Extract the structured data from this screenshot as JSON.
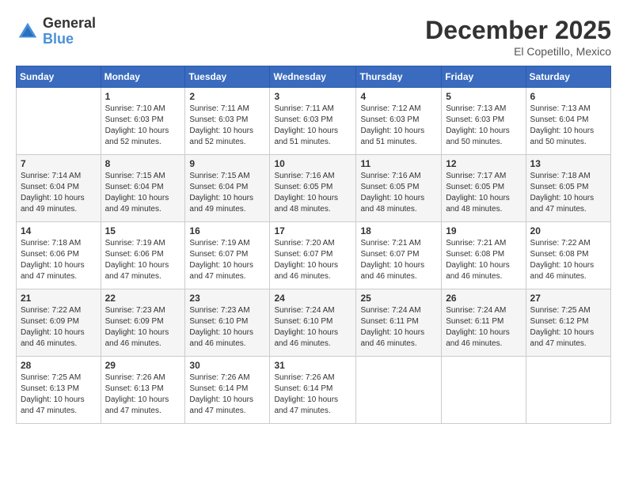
{
  "logo": {
    "general": "General",
    "blue": "Blue"
  },
  "title": "December 2025",
  "location": "El Copetillo, Mexico",
  "days_of_week": [
    "Sunday",
    "Monday",
    "Tuesday",
    "Wednesday",
    "Thursday",
    "Friday",
    "Saturday"
  ],
  "weeks": [
    [
      {
        "day": "",
        "info": ""
      },
      {
        "day": "1",
        "info": "Sunrise: 7:10 AM\nSunset: 6:03 PM\nDaylight: 10 hours\nand 52 minutes."
      },
      {
        "day": "2",
        "info": "Sunrise: 7:11 AM\nSunset: 6:03 PM\nDaylight: 10 hours\nand 52 minutes."
      },
      {
        "day": "3",
        "info": "Sunrise: 7:11 AM\nSunset: 6:03 PM\nDaylight: 10 hours\nand 51 minutes."
      },
      {
        "day": "4",
        "info": "Sunrise: 7:12 AM\nSunset: 6:03 PM\nDaylight: 10 hours\nand 51 minutes."
      },
      {
        "day": "5",
        "info": "Sunrise: 7:13 AM\nSunset: 6:03 PM\nDaylight: 10 hours\nand 50 minutes."
      },
      {
        "day": "6",
        "info": "Sunrise: 7:13 AM\nSunset: 6:04 PM\nDaylight: 10 hours\nand 50 minutes."
      }
    ],
    [
      {
        "day": "7",
        "info": "Sunrise: 7:14 AM\nSunset: 6:04 PM\nDaylight: 10 hours\nand 49 minutes."
      },
      {
        "day": "8",
        "info": "Sunrise: 7:15 AM\nSunset: 6:04 PM\nDaylight: 10 hours\nand 49 minutes."
      },
      {
        "day": "9",
        "info": "Sunrise: 7:15 AM\nSunset: 6:04 PM\nDaylight: 10 hours\nand 49 minutes."
      },
      {
        "day": "10",
        "info": "Sunrise: 7:16 AM\nSunset: 6:05 PM\nDaylight: 10 hours\nand 48 minutes."
      },
      {
        "day": "11",
        "info": "Sunrise: 7:16 AM\nSunset: 6:05 PM\nDaylight: 10 hours\nand 48 minutes."
      },
      {
        "day": "12",
        "info": "Sunrise: 7:17 AM\nSunset: 6:05 PM\nDaylight: 10 hours\nand 48 minutes."
      },
      {
        "day": "13",
        "info": "Sunrise: 7:18 AM\nSunset: 6:05 PM\nDaylight: 10 hours\nand 47 minutes."
      }
    ],
    [
      {
        "day": "14",
        "info": "Sunrise: 7:18 AM\nSunset: 6:06 PM\nDaylight: 10 hours\nand 47 minutes."
      },
      {
        "day": "15",
        "info": "Sunrise: 7:19 AM\nSunset: 6:06 PM\nDaylight: 10 hours\nand 47 minutes."
      },
      {
        "day": "16",
        "info": "Sunrise: 7:19 AM\nSunset: 6:07 PM\nDaylight: 10 hours\nand 47 minutes."
      },
      {
        "day": "17",
        "info": "Sunrise: 7:20 AM\nSunset: 6:07 PM\nDaylight: 10 hours\nand 46 minutes."
      },
      {
        "day": "18",
        "info": "Sunrise: 7:21 AM\nSunset: 6:07 PM\nDaylight: 10 hours\nand 46 minutes."
      },
      {
        "day": "19",
        "info": "Sunrise: 7:21 AM\nSunset: 6:08 PM\nDaylight: 10 hours\nand 46 minutes."
      },
      {
        "day": "20",
        "info": "Sunrise: 7:22 AM\nSunset: 6:08 PM\nDaylight: 10 hours\nand 46 minutes."
      }
    ],
    [
      {
        "day": "21",
        "info": "Sunrise: 7:22 AM\nSunset: 6:09 PM\nDaylight: 10 hours\nand 46 minutes."
      },
      {
        "day": "22",
        "info": "Sunrise: 7:23 AM\nSunset: 6:09 PM\nDaylight: 10 hours\nand 46 minutes."
      },
      {
        "day": "23",
        "info": "Sunrise: 7:23 AM\nSunset: 6:10 PM\nDaylight: 10 hours\nand 46 minutes."
      },
      {
        "day": "24",
        "info": "Sunrise: 7:24 AM\nSunset: 6:10 PM\nDaylight: 10 hours\nand 46 minutes."
      },
      {
        "day": "25",
        "info": "Sunrise: 7:24 AM\nSunset: 6:11 PM\nDaylight: 10 hours\nand 46 minutes."
      },
      {
        "day": "26",
        "info": "Sunrise: 7:24 AM\nSunset: 6:11 PM\nDaylight: 10 hours\nand 46 minutes."
      },
      {
        "day": "27",
        "info": "Sunrise: 7:25 AM\nSunset: 6:12 PM\nDaylight: 10 hours\nand 47 minutes."
      }
    ],
    [
      {
        "day": "28",
        "info": "Sunrise: 7:25 AM\nSunset: 6:13 PM\nDaylight: 10 hours\nand 47 minutes."
      },
      {
        "day": "29",
        "info": "Sunrise: 7:26 AM\nSunset: 6:13 PM\nDaylight: 10 hours\nand 47 minutes."
      },
      {
        "day": "30",
        "info": "Sunrise: 7:26 AM\nSunset: 6:14 PM\nDaylight: 10 hours\nand 47 minutes."
      },
      {
        "day": "31",
        "info": "Sunrise: 7:26 AM\nSunset: 6:14 PM\nDaylight: 10 hours\nand 47 minutes."
      },
      {
        "day": "",
        "info": ""
      },
      {
        "day": "",
        "info": ""
      },
      {
        "day": "",
        "info": ""
      }
    ]
  ]
}
